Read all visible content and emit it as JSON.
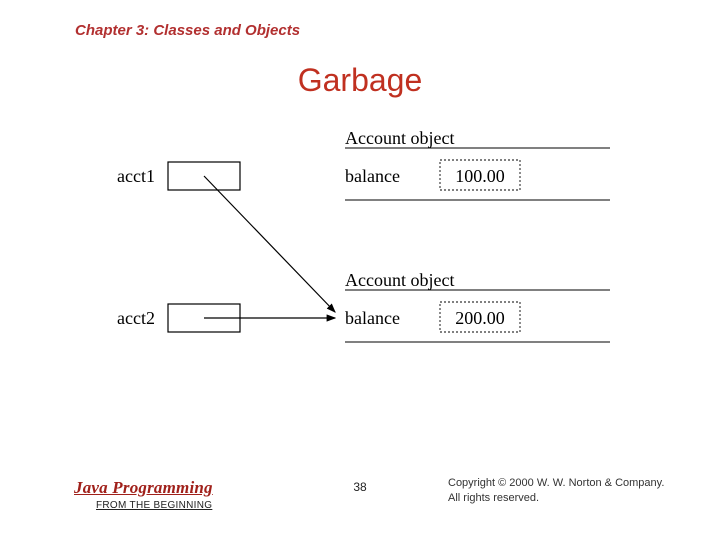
{
  "chapter": "Chapter 3: Classes and Objects",
  "title": "Garbage",
  "diagram": {
    "var1": "acct1",
    "var2": "acct2",
    "obj_label": "Account object",
    "field_label": "balance",
    "val1": "100.00",
    "val2": "200.00"
  },
  "footer": {
    "book_title": "Java Programming",
    "subtitle": "FROM THE BEGINNING",
    "page_num": "38",
    "copyright_line1": "Copyright © 2000 W. W. Norton & Company.",
    "copyright_line2": "All rights reserved."
  }
}
